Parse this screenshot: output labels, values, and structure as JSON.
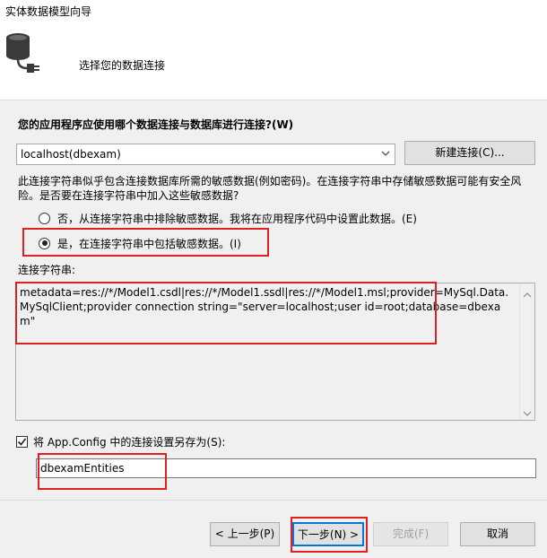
{
  "window": {
    "title": "实体数据模型向导"
  },
  "header": {
    "title": "选择您的数据连接",
    "icon": "database-plug-icon"
  },
  "connection": {
    "question": "您的应用程序应使用哪个数据连接与数据库进行连接?(W)",
    "selected": "localhost(dbexam)",
    "new_button": "新建连接(C)..."
  },
  "sensitive": {
    "warning": "此连接字符串似乎包含连接数据库所需的敏感数据(例如密码)。在连接字符串中存储敏感数据可能有安全风险。是否要在连接字符串中加入这些敏感数据?",
    "option_exclude": "否，从连接字符串中排除敏感数据。我将在应用程序代码中设置此数据。(E)",
    "option_include": "是，在连接字符串中包括敏感数据。(I)",
    "selected": "include"
  },
  "connection_string": {
    "label": "连接字符串:",
    "value": "metadata=res://*/Model1.csdl|res://*/Model1.ssdl|res://*/Model1.msl;provider=MySql.Data.MySqlClient;provider connection string=\"server=localhost;user id=root;database=dbexam\""
  },
  "save": {
    "checked": true,
    "label": "将 App.Config 中的连接设置另存为(S):",
    "value": "dbexamEntities"
  },
  "footer": {
    "prev": "< 上一步(P)",
    "next": "下一步(N) >",
    "finish": "完成(F)",
    "cancel": "取消"
  },
  "colors": {
    "highlight": "#e02020",
    "focus": "#0078d7"
  }
}
